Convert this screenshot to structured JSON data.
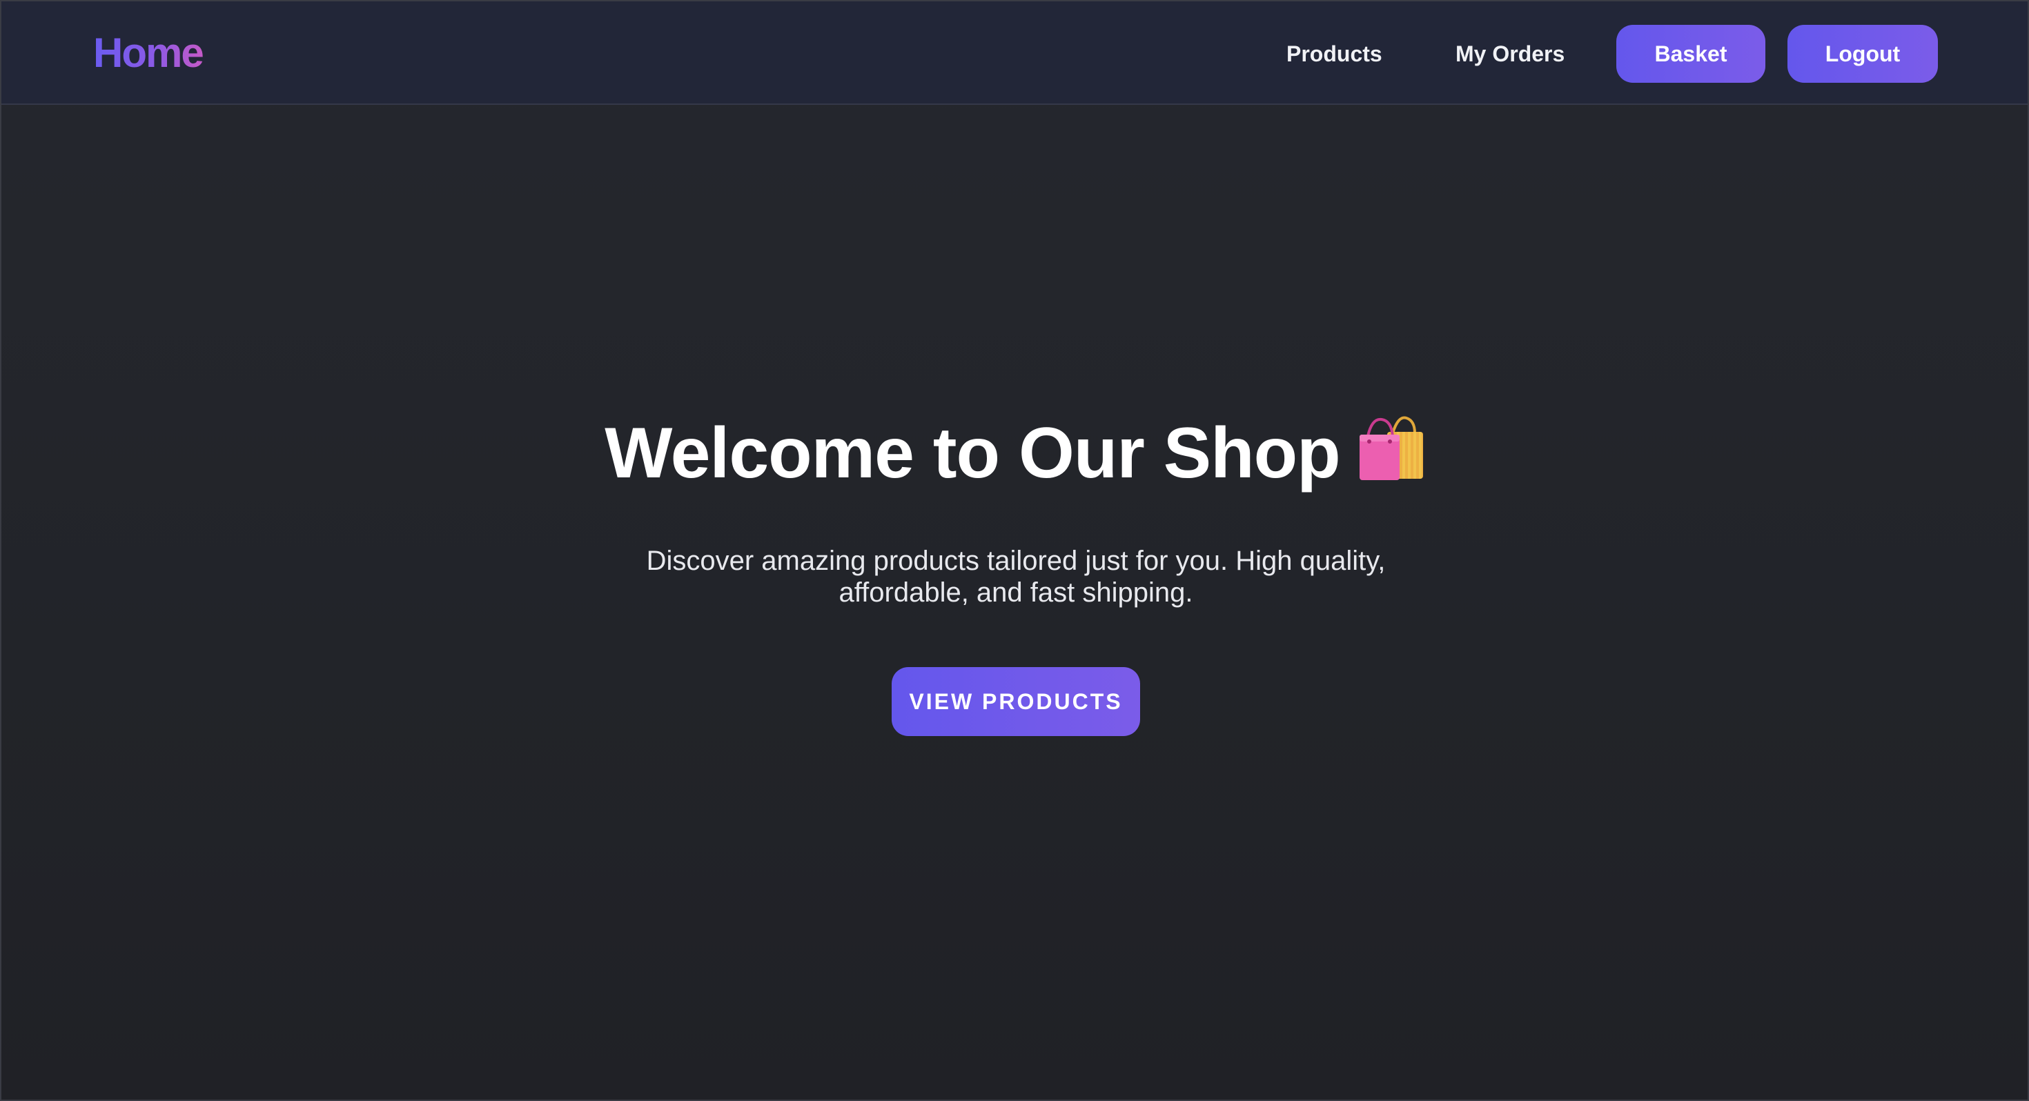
{
  "navbar": {
    "logo": "Home",
    "links": {
      "products": "Products",
      "my_orders": "My Orders"
    },
    "buttons": {
      "basket": "Basket",
      "logout": "Logout"
    }
  },
  "hero": {
    "title": "Welcome to Our Shop",
    "title_icon": "shopping-bags-icon",
    "subtitle": "Discover amazing products tailored just for you. High quality, affordable, and fast shipping.",
    "cta_label": "VIEW PRODUCTS"
  },
  "colors": {
    "background": "#222328",
    "navbar": "#222638",
    "accent_start": "#6457ec",
    "accent_end": "#7b5ce9",
    "logo_gradient_end": "#c55ac8",
    "text": "#ffffff"
  }
}
